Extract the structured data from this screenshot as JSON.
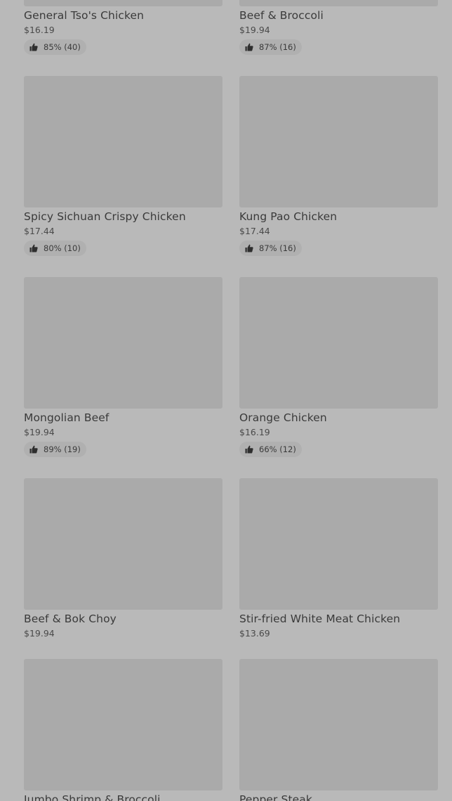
{
  "menu": {
    "items": [
      {
        "name": "General Tso's Chicken",
        "price": "$16.19",
        "rating": "85% (40)"
      },
      {
        "name": "Beef & Broccoli",
        "price": "$19.94",
        "rating": "87% (16)"
      },
      {
        "name": "Spicy Sichuan Crispy Chicken",
        "price": "$17.44",
        "rating": "80% (10)"
      },
      {
        "name": "Kung Pao Chicken",
        "price": "$17.44",
        "rating": "87% (16)"
      },
      {
        "name": "Mongolian Beef",
        "price": "$19.94",
        "rating": "89% (19)"
      },
      {
        "name": "Orange Chicken",
        "price": "$16.19",
        "rating": "66% (12)"
      },
      {
        "name": "Beef & Bok Choy",
        "price": "$19.94"
      },
      {
        "name": "Stir-fried White Meat Chicken",
        "price": "$13.69"
      },
      {
        "name": "Jumbo Shrimp & Broccoli"
      },
      {
        "name": "Pepper Steak"
      }
    ]
  },
  "icons": {
    "rating": "thumbs-up-icon"
  },
  "colors": {
    "background": "#b9b9b9",
    "image_placeholder": "#aaaaaa",
    "rating_pill": "#b0b0b0",
    "text": "#3a3a3a"
  }
}
